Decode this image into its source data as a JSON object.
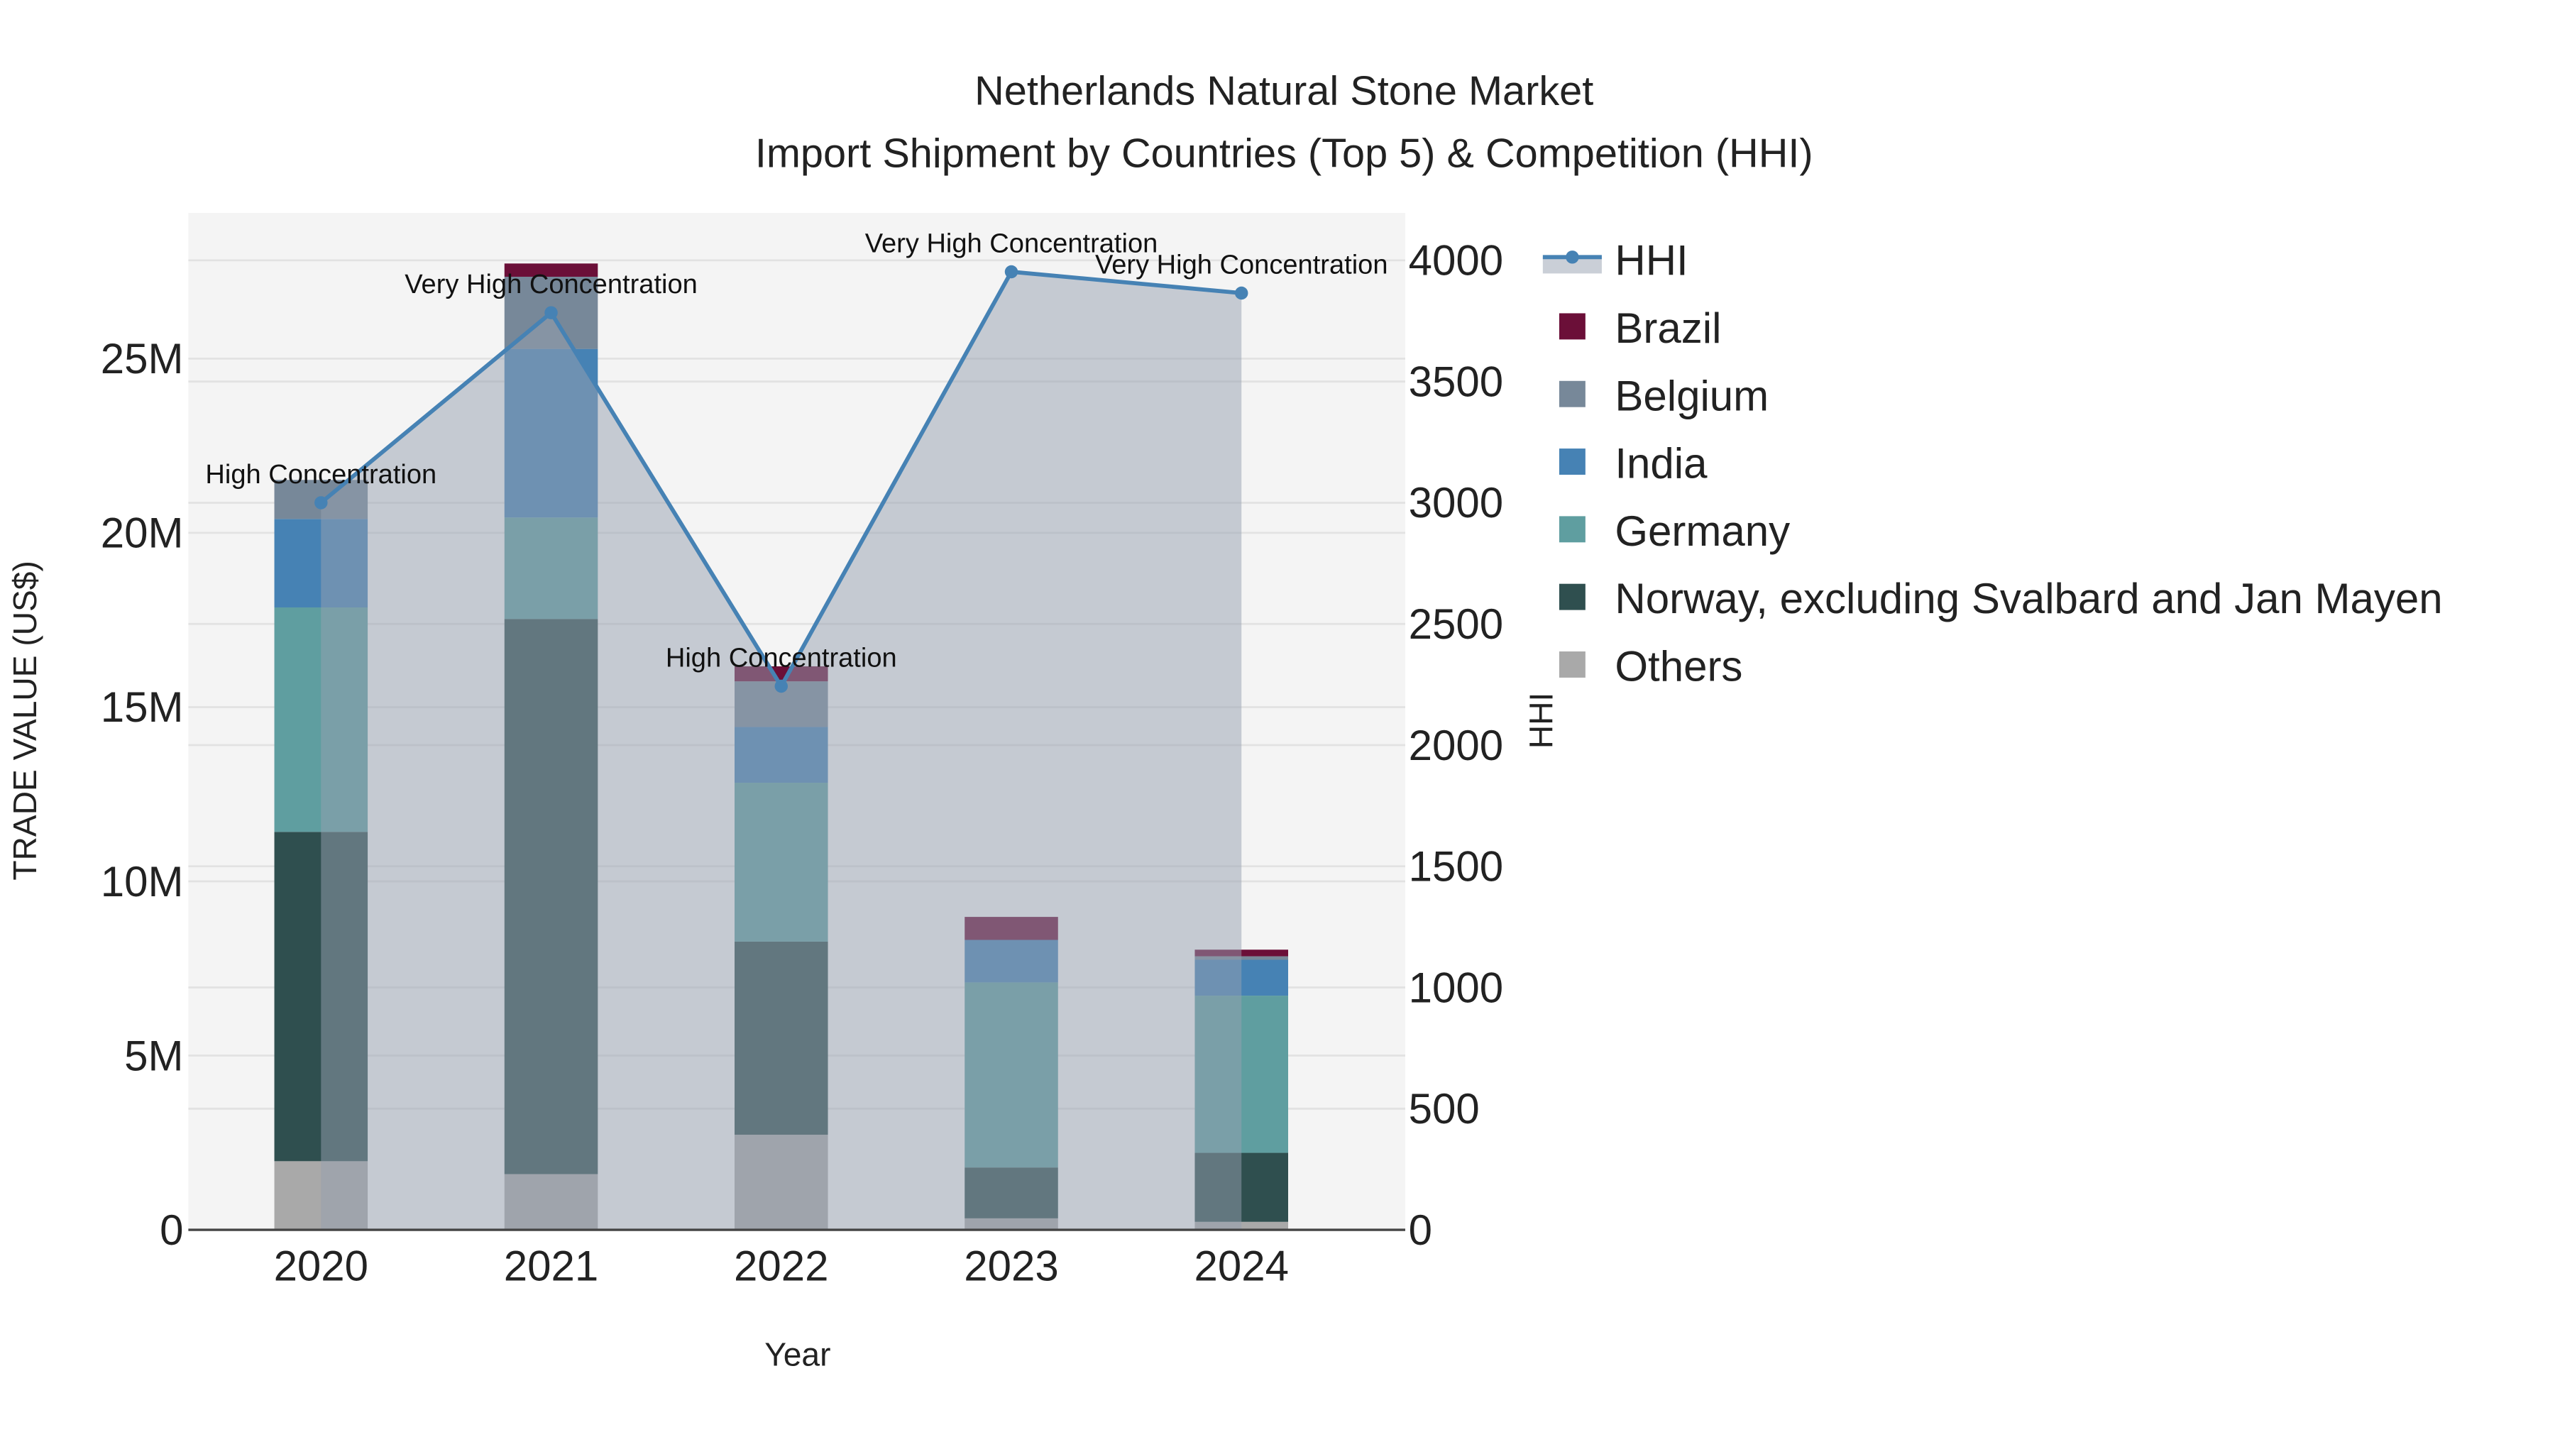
{
  "chart_data": {
    "type": "bar",
    "title": "Netherlands Natural Stone Market",
    "subtitle": "Import Shipment by Countries (Top 5) & Competition (HHI)",
    "xlabel": "Year",
    "ylabel": "TRADE VALUE (US$)",
    "y2label": "HHI",
    "categories": [
      "2020",
      "2021",
      "2022",
      "2023",
      "2024"
    ],
    "ylim": [
      0,
      29000000
    ],
    "y2lim": [
      0,
      4200
    ],
    "yticks": [
      0,
      5000000,
      10000000,
      15000000,
      20000000,
      25000000
    ],
    "ytick_labels": [
      "0",
      "5M",
      "10M",
      "15M",
      "20M",
      "25M"
    ],
    "y2ticks": [
      0,
      500,
      1000,
      1500,
      2000,
      2500,
      3000,
      3500,
      4000
    ],
    "y2tick_labels": [
      "0",
      "500",
      "1000",
      "1500",
      "2000",
      "2500",
      "3000",
      "3500",
      "4000"
    ],
    "series": [
      {
        "name": "Others",
        "color": "#a9a9a9",
        "values": [
          1970000,
          1600000,
          2730000,
          330000,
          230000
        ]
      },
      {
        "name": "Norway, excluding Svalbard and Jan Mayen",
        "color": "#2f4f4f",
        "values": [
          9450000,
          15930000,
          5540000,
          1460000,
          1980000
        ]
      },
      {
        "name": "Germany",
        "color": "#5f9ea0",
        "values": [
          6440000,
          2910000,
          4560000,
          5310000,
          4510000
        ]
      },
      {
        "name": "India",
        "color": "#4682b4",
        "values": [
          2540000,
          4840000,
          1600000,
          1220000,
          1030000
        ]
      },
      {
        "name": "Belgium",
        "color": "#778899",
        "values": [
          1120000,
          2070000,
          1310000,
          0,
          100000
        ]
      },
      {
        "name": "Brazil",
        "color": "#6b0f38",
        "values": [
          0,
          380000,
          430000,
          660000,
          190000
        ]
      }
    ],
    "hhi": {
      "name": "HHI",
      "color": "#4682b4",
      "values": [
        3000,
        3784,
        2243,
        3953,
        3865
      ],
      "annotations": [
        "High Concentration",
        "Very High Concentration",
        "High Concentration",
        "Very High Concentration",
        "Very High Concentration"
      ]
    },
    "legend": [
      "HHI",
      "Brazil",
      "Belgium",
      "India",
      "Germany",
      "Norway, excluding Svalbard and Jan Mayen",
      "Others"
    ],
    "legend_position": "right",
    "grid": true
  }
}
